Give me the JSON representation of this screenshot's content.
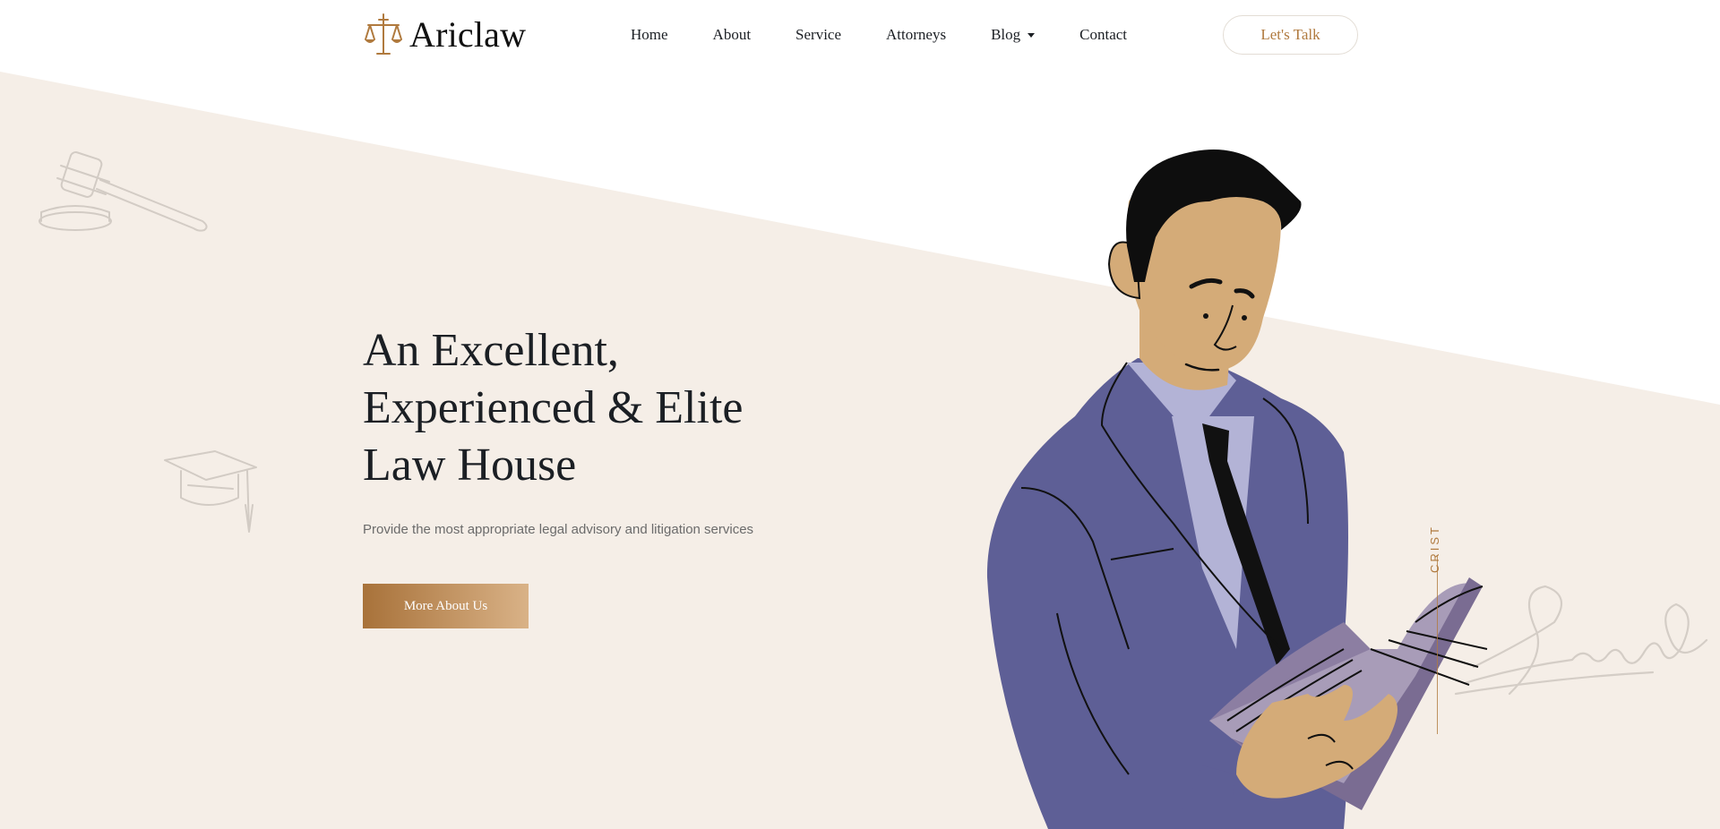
{
  "brand": {
    "name": "Ariclaw",
    "accent": "#b07a3e"
  },
  "nav": {
    "items": [
      {
        "label": "Home"
      },
      {
        "label": "About"
      },
      {
        "label": "Service"
      },
      {
        "label": "Attorneys"
      },
      {
        "label": "Blog",
        "dropdown": true
      },
      {
        "label": "Contact"
      }
    ],
    "cta_label": "Let's Talk"
  },
  "hero": {
    "title_lines": [
      "An Excellent,",
      "Experienced & Elite",
      "Law House"
    ],
    "subtitle": "Provide the most appropriate legal advisory and litigation services",
    "button_label": "More About Us",
    "vertical_label": "CRIST"
  },
  "colors": {
    "background": "#ffffff",
    "slab": "#f5eee7",
    "suit": "#5e5f96",
    "skin": "#d4ab78",
    "button_start": "#a8723a",
    "button_end": "#d9b287"
  },
  "icons": [
    "scales-of-justice-icon",
    "gavel-icon",
    "graduation-cap-icon",
    "signature-icon",
    "caret-down-icon"
  ]
}
